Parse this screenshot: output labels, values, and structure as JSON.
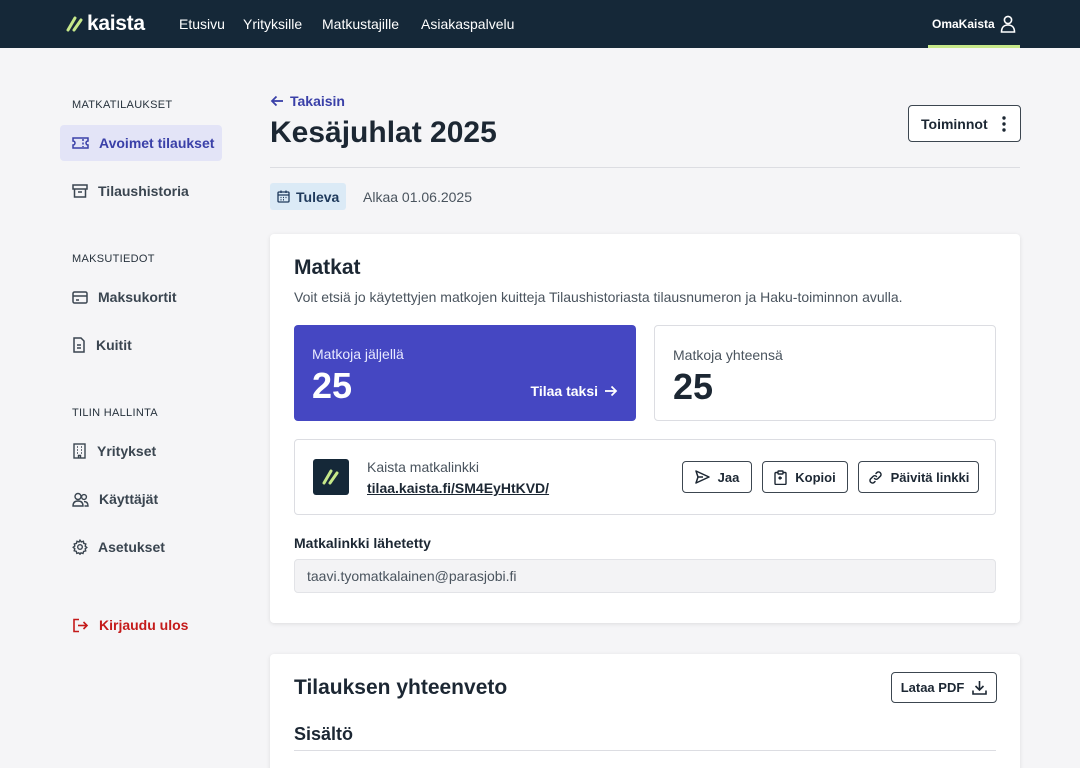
{
  "header": {
    "logo_text": "kaista",
    "nav": [
      "Etusivu",
      "Yrityksille",
      "Matkustajille",
      "Asiakaspalvelu"
    ],
    "account_label": "OmaKaista",
    "accent_color": "#c6e88a"
  },
  "sidebar": {
    "sections": [
      {
        "heading": "MATKATILAUKSET",
        "items": [
          {
            "label": "Avoimet tilaukset",
            "icon": "ticket-icon",
            "active": true
          },
          {
            "label": "Tilaushistoria",
            "icon": "archive-icon"
          }
        ]
      },
      {
        "heading": "MAKSUTIEDOT",
        "items": [
          {
            "label": "Maksukortit",
            "icon": "credit-card-icon"
          },
          {
            "label": "Kuitit",
            "icon": "receipt-icon"
          }
        ]
      },
      {
        "heading": "TILIN HALLINTA",
        "items": [
          {
            "label": "Yritykset",
            "icon": "building-icon"
          },
          {
            "label": "Käyttäjät",
            "icon": "users-icon"
          },
          {
            "label": "Asetukset",
            "icon": "gear-icon"
          }
        ]
      }
    ],
    "logout_label": "Kirjaudu ulos"
  },
  "page": {
    "back_label": "Takaisin",
    "title": "Kesäjuhlat 2025",
    "actions_label": "Toiminnot",
    "status": "Tuleva",
    "start_text": "Alkaa 01.06.2025"
  },
  "trips": {
    "title": "Matkat",
    "description": "Voit etsiä jo käytettyjen matkojen kuitteja Tilaushistoriasta tilausnumeron ja Haku-toiminnon avulla.",
    "remaining_label": "Matkoja jäljellä",
    "remaining_value": "25",
    "order_taxi_label": "Tilaa taksi",
    "total_label": "Matkoja yhteensä",
    "total_value": "25",
    "link_label": "Kaista matkalinkki",
    "link_url": "tilaa.kaista.fi/SM4EyHtKVD/",
    "share_label": "Jaa",
    "copy_label": "Kopioi",
    "refresh_label": "Päivitä linkki",
    "sent_label": "Matkalinkki lähetetty",
    "sent_email": "taavi.tyomatkalainen@parasjobi.fi"
  },
  "summary": {
    "title": "Tilauksen yhteenveto",
    "pdf_label": "Lataa PDF",
    "content_heading": "Sisältö"
  }
}
